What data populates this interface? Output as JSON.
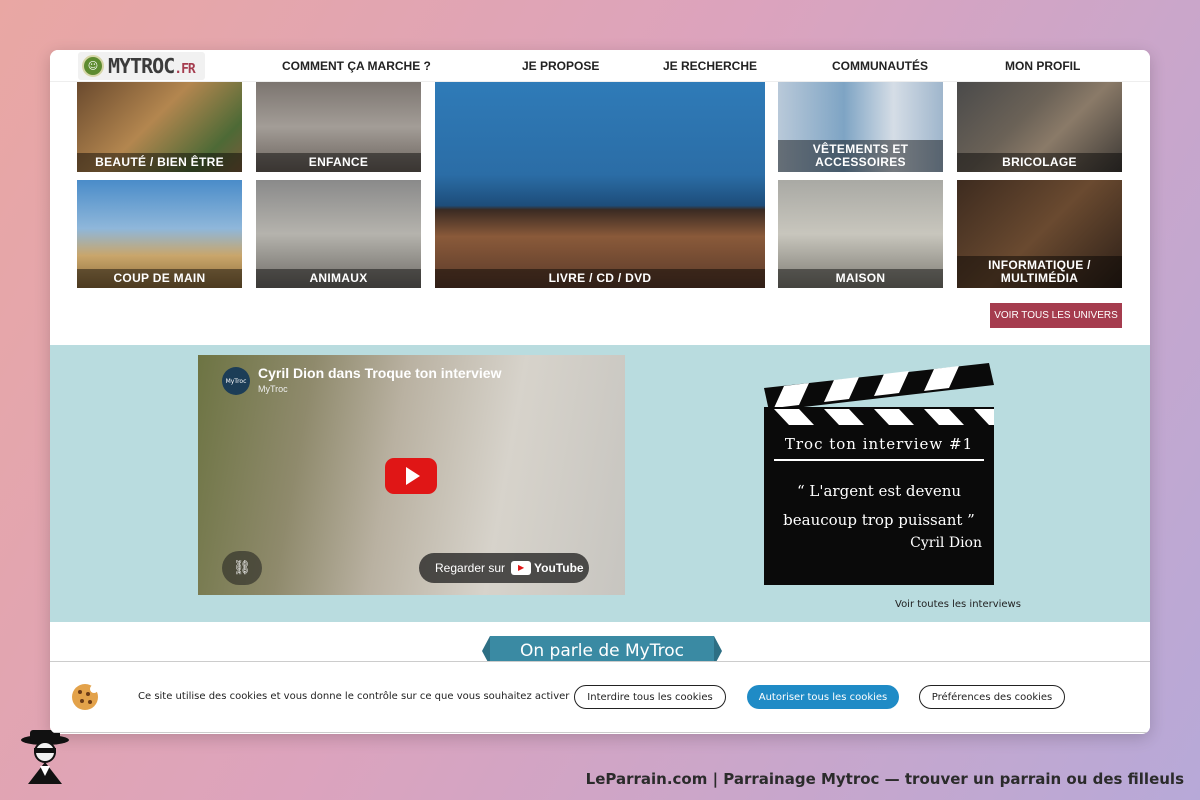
{
  "nav": {
    "logo_main": "MYTROC",
    "logo_suffix": ".FR",
    "items": [
      "COMMENT ÇA MARCHE ?",
      "JE PROPOSE",
      "JE RECHERCHE",
      "COMMUNAUTÉS",
      "MON PROFIL"
    ]
  },
  "categories": [
    {
      "label": "BEAUTÉ / BIEN ÊTRE"
    },
    {
      "label": "ENFANCE"
    },
    {
      "label": "LIVRE / CD / DVD"
    },
    {
      "label": "VÊTEMENTS ET ACCESSOIRES"
    },
    {
      "label": "BRICOLAGE"
    },
    {
      "label": "COUP DE MAIN"
    },
    {
      "label": "ANIMAUX"
    },
    {
      "label": "MAISON"
    },
    {
      "label": "INFORMATIQUE / MULTIMÉDIA"
    }
  ],
  "voir_univers": "VOIR TOUS LES UNIVERS",
  "interview": {
    "video_title": "Cyril Dion dans Troque ton interview",
    "channel": "MyTroc",
    "watch_label": "Regarder sur",
    "youtube_word": "YouTube",
    "clap_title": "Troc ton interview #1",
    "quote": "“ L'argent est devenu beaucoup trop puissant ”",
    "author": "Cyril Dion",
    "voir_toutes": "Voir toutes les interviews"
  },
  "banner": "On parle de MyTroc",
  "cookie": {
    "text": "Ce site utilise des cookies et vous donne le contrôle sur ce que vous souhaitez activer",
    "deny": "Interdire tous les cookies",
    "allow": "Autoriser tous les cookies",
    "prefs": "Préférences des cookies"
  },
  "footer": "LeParrain.com | Parrainage Mytroc — trouver un parrain ou des filleuls",
  "colors": {
    "accent": "#a53c4e",
    "interview_bg": "#b9dcdf",
    "cookie_allow": "#1f8bc6",
    "banner": "#3a8aa3"
  }
}
